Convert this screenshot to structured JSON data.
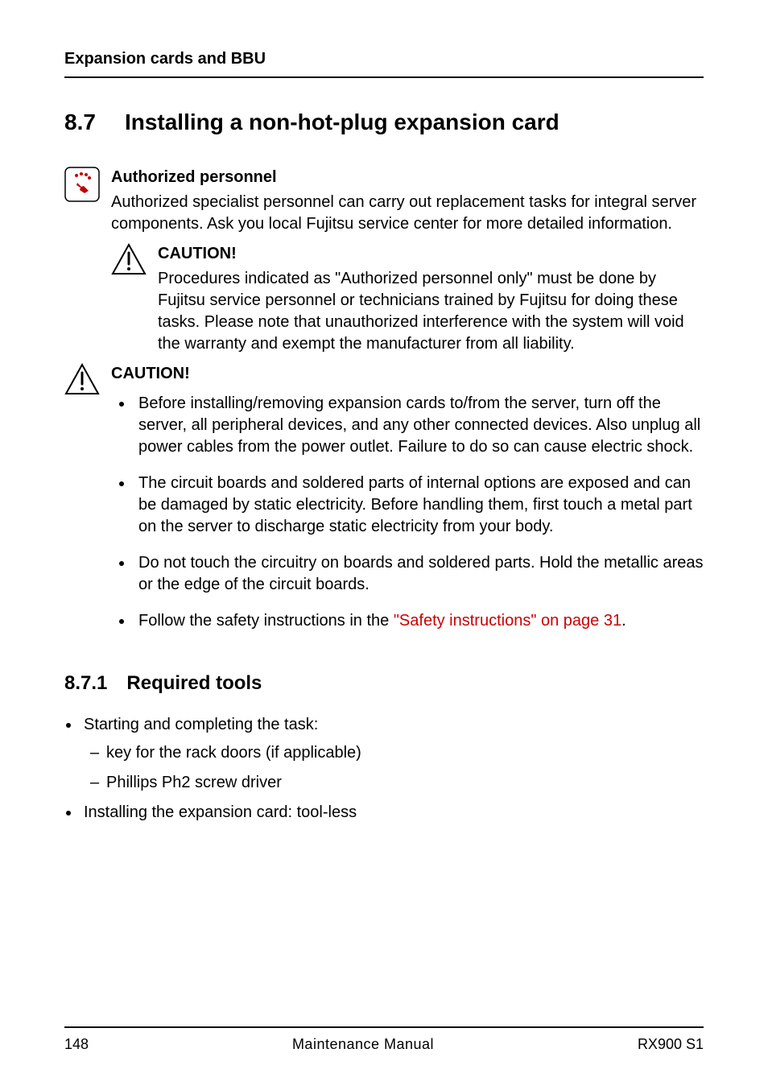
{
  "running_head": "Expansion cards and BBU",
  "section": {
    "number": "8.7",
    "title": "Installing a non-hot-plug expansion card"
  },
  "authorized": {
    "label": "Authorized personnel",
    "body": "Authorized specialist personnel can carry out replacement tasks for integral server components. Ask you local Fujitsu service center for more detailed information."
  },
  "caution_inner": {
    "label": "CAUTION!",
    "body": "Procedures indicated as \"Authorized personnel only\" must be done by Fujitsu service personnel or technicians trained by Fujitsu for doing these tasks. Please note that unauthorized interference with the system will void the warranty and exempt the manufacturer from all liability."
  },
  "caution_outer": {
    "label": "CAUTION!",
    "items": [
      "Before installing/removing expansion cards to/from the server, turn off the server, all peripheral devices, and any other connected devices. Also unplug all power cables from the power outlet. Failure to do so can cause electric shock.",
      "The circuit boards and soldered parts of internal options are exposed and can be damaged by static electricity. Before handling them, first touch a metal part on the server to discharge static electricity from your body.",
      "Do not touch the circuitry on boards and soldered parts. Hold the metallic areas or the edge of the circuit boards."
    ],
    "last_item_prefix": "Follow the safety instructions in the ",
    "last_item_link": "\"Safety instructions\" on page 31",
    "last_item_suffix": "."
  },
  "subsection": {
    "number": "8.7.1",
    "title": "Required tools"
  },
  "required_tools": {
    "item1": "Starting and completing the task:",
    "sub1": "key for the rack doors (if applicable)",
    "sub2": "Phillips Ph2 screw driver",
    "item2": "Installing the expansion card: tool-less"
  },
  "footer": {
    "page": "148",
    "center": "Maintenance Manual",
    "right": "RX900 S1"
  }
}
